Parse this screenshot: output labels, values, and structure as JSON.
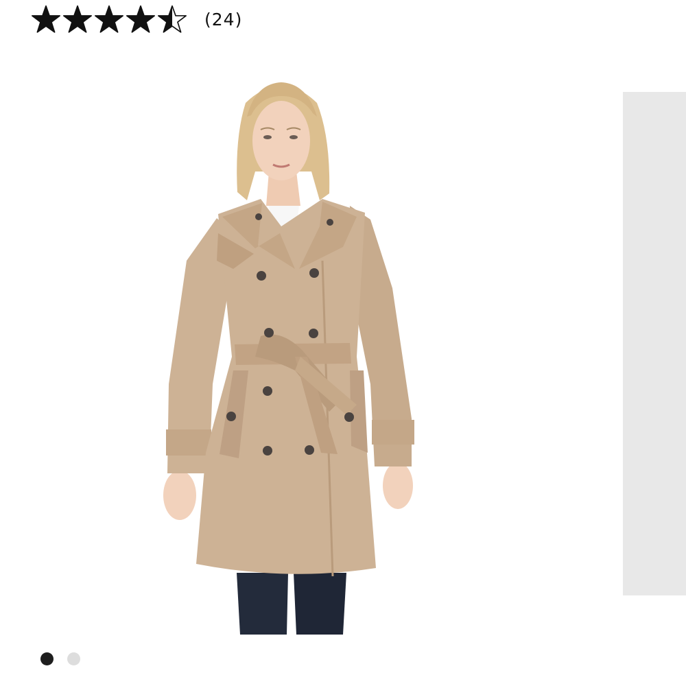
{
  "rating": {
    "value": 4.5,
    "max": 5,
    "review_count": "(24)",
    "star_color": "#111111"
  },
  "product": {
    "image_icon": "trench-coat-model-photo",
    "coat_color": "#cdb295",
    "coat_shadow": "#b99b7c",
    "button_color": "#4a4340",
    "hair_color": "#dcbf8f",
    "skin_color": "#f2d2bc",
    "jeans_color": "#232b3b"
  },
  "gallery": {
    "current_index": 1,
    "total": 2,
    "active_dot_color": "#1e1e1e",
    "inactive_dot_color": "#dddddd",
    "peek_color": "#e8e8e8"
  }
}
